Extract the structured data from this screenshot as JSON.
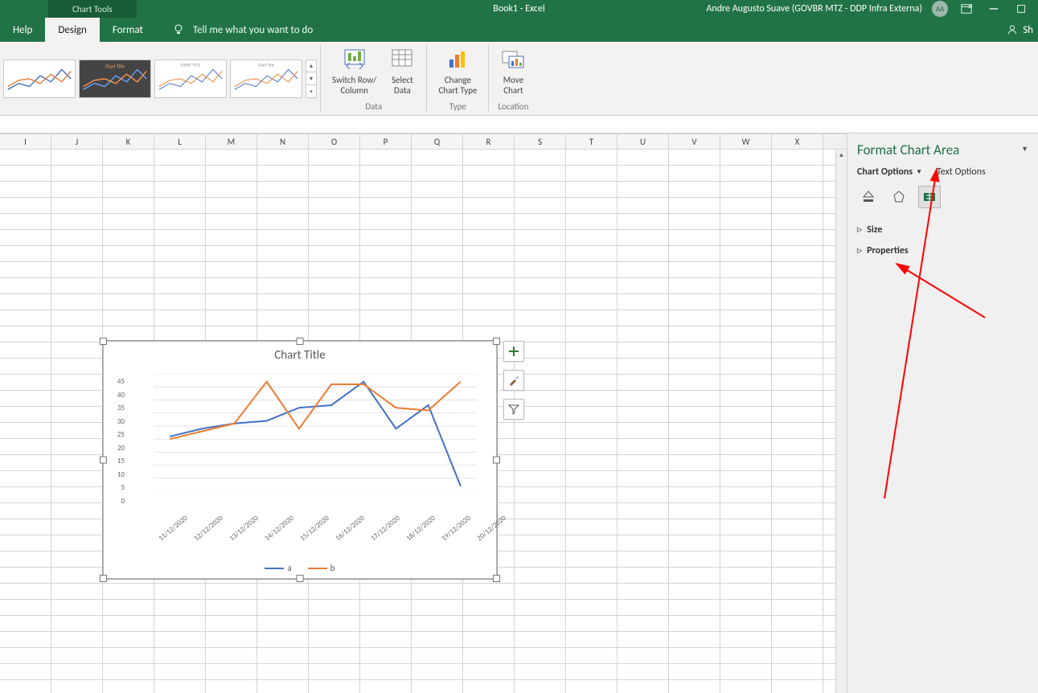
{
  "titlebar": {
    "chart_tools": "Chart Tools",
    "doc": "Book1  -  Excel",
    "user": "Andre Augusto Suave (GOVBR MTZ - DDP Infra Externa)",
    "avatar": "AA",
    "share": "Sh"
  },
  "tabs": {
    "help": "Help",
    "design": "Design",
    "format": "Format",
    "tell_me": "Tell me what you want to do"
  },
  "ribbon": {
    "switch": "Switch Row/\nColumn",
    "select": "Select\nData",
    "change": "Change\nChart Type",
    "move": "Move\nChart",
    "group_data": "Data",
    "group_type": "Type",
    "group_location": "Location"
  },
  "columns": [
    "I",
    "J",
    "K",
    "L",
    "M",
    "N",
    "O",
    "P",
    "Q",
    "R",
    "S",
    "T",
    "U",
    "V",
    "W",
    "X"
  ],
  "chart_data": {
    "type": "line",
    "title": "Chart Title",
    "xlabel": "",
    "ylabel": "",
    "ylim": [
      0,
      45
    ],
    "yticks": [
      0,
      5,
      10,
      15,
      20,
      25,
      30,
      35,
      40,
      45
    ],
    "categories": [
      "11/12/2020",
      "12/12/2020",
      "13/12/2020",
      "14/12/2020",
      "15/12/2020",
      "16/12/2020",
      "17/12/2020",
      "18/12/2020",
      "19/12/2020",
      "20/12/2020"
    ],
    "series": [
      {
        "name": "a",
        "color": "#4472C4",
        "values": [
          21,
          24,
          26,
          27,
          32,
          33,
          42,
          24,
          33,
          2
        ]
      },
      {
        "name": "b",
        "color": "#ED7D31",
        "values": [
          20,
          23,
          26,
          42,
          24,
          41,
          41,
          32,
          31,
          42
        ]
      }
    ]
  },
  "format_pane": {
    "title": "Format Chart Area",
    "tab_chart": "Chart Options",
    "tab_text": "Text Options",
    "section_size": "Size",
    "section_properties": "Properties"
  }
}
